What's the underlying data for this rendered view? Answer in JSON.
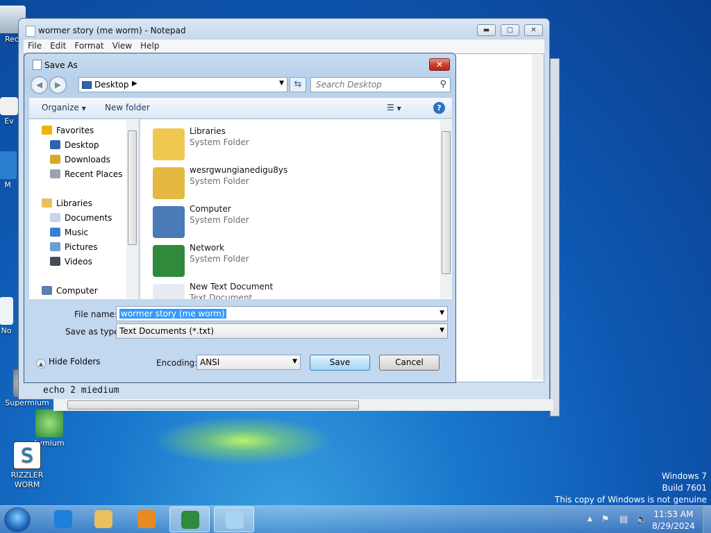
{
  "desktop": {
    "icons": [
      {
        "label": "Rec"
      },
      {
        "label": "Ev"
      },
      {
        "label": "M"
      },
      {
        "label": "No"
      },
      {
        "label": "Supermium"
      },
      {
        "label": "Lymium"
      },
      {
        "label": "RIZZLER WORM"
      }
    ],
    "watermark": {
      "line1": "Windows 7",
      "line2": "Build 7601",
      "line3": "This copy of Windows is not genuine"
    }
  },
  "notepad": {
    "title": "wormer story (me worm) - Notepad",
    "menu": [
      "File",
      "Edit",
      "Format",
      "View",
      "Help"
    ],
    "content_visible": "echo 2 miedium"
  },
  "save_dialog": {
    "title": "Save As",
    "address": "Desktop",
    "search_placeholder": "Search Desktop",
    "toolbar": {
      "organize": "Organize",
      "new_folder": "New folder"
    },
    "nav": [
      {
        "label": "Favorites",
        "icon": "star-icon",
        "color": "#f0b400"
      },
      {
        "label": "Desktop",
        "icon": "desktop-icon",
        "color": "#2d64b0"
      },
      {
        "label": "Downloads",
        "icon": "downloads-folder-icon",
        "color": "#d9a728"
      },
      {
        "label": "Recent Places",
        "icon": "recent-places-icon",
        "color": "#9aa4b0"
      },
      {
        "label": "Libraries",
        "icon": "libraries-icon",
        "color": "#e8c060"
      },
      {
        "label": "Documents",
        "icon": "documents-icon",
        "color": "#c9d6e8"
      },
      {
        "label": "Music",
        "icon": "music-icon",
        "color": "#3a7fd0"
      },
      {
        "label": "Pictures",
        "icon": "pictures-icon",
        "color": "#6aa0d0"
      },
      {
        "label": "Videos",
        "icon": "videos-icon",
        "color": "#444c58"
      },
      {
        "label": "Computer",
        "icon": "computer-icon",
        "color": "#5a7fb0"
      }
    ],
    "items": [
      {
        "name": "Libraries",
        "type": "System Folder",
        "icon": "libraries-folder-icon",
        "color": "#f0c850"
      },
      {
        "name": "wesrgwungianedigu8ys",
        "type": "System Folder",
        "icon": "user-folder-icon",
        "color": "#e5b840"
      },
      {
        "name": "Computer",
        "type": "System Folder",
        "icon": "computer-icon",
        "color": "#4a7ab8"
      },
      {
        "name": "Network",
        "type": "System Folder",
        "icon": "network-globe-icon",
        "color": "#2f8a3c"
      },
      {
        "name": "New Text Document",
        "type": "Text Document",
        "icon": "text-document-icon",
        "color": "#e8ecf2"
      }
    ],
    "file_name_label": "File name:",
    "file_name_value": "wormer story (me worm)",
    "save_type_label": "Save as type:",
    "save_type_value": "Text Documents (*.txt)",
    "hide_folders": "Hide Folders",
    "encoding_label": "Encoding:",
    "encoding_value": "ANSI",
    "save_button": "Save",
    "cancel_button": "Cancel"
  },
  "taskbar": {
    "apps": [
      {
        "name": "internet-explorer-icon",
        "color": "#1e7fd8"
      },
      {
        "name": "explorer-folder-icon",
        "color": "#e8c060"
      },
      {
        "name": "media-player-icon",
        "color": "#e88a20"
      },
      {
        "name": "globe-app-icon",
        "color": "#2f8a3c"
      },
      {
        "name": "notepad-icon",
        "color": "#a8d4f0"
      }
    ],
    "time": "11:53 AM",
    "date": "8/29/2024"
  }
}
